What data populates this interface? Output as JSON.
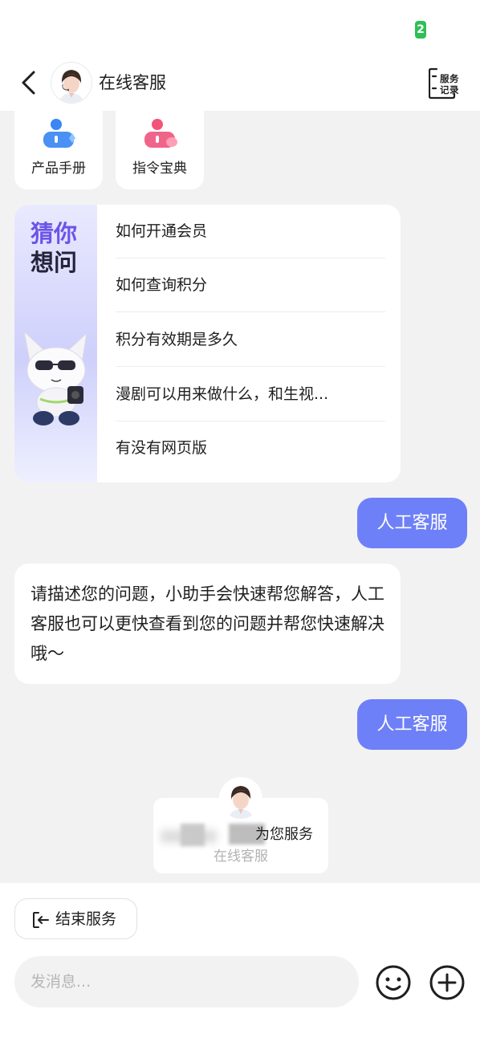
{
  "status_bar": {
    "battery_text": "2"
  },
  "header": {
    "title": "在线客服",
    "service_record_line1": "服务",
    "service_record_line2": "记录"
  },
  "quick_tools": [
    {
      "label": "产品手册",
      "icon": "product-manual-icon",
      "color": "#3a86f2"
    },
    {
      "label": "指令宝典",
      "icon": "command-book-icon",
      "color": "#f2557a"
    }
  ],
  "guess": {
    "title_line1": "猜你",
    "title_line2": "想问",
    "questions": [
      "如何开通会员",
      "如何查询积分",
      "积分有效期是多久",
      "漫剧可以用来做什么，和生视...",
      "有没有网页版"
    ]
  },
  "messages": {
    "user_1": "人工客服",
    "bot_1": "请描述您的问题，小助手会快速帮您解答，人工客服也可以更快查看到您的问题并帮您快速解决哦～",
    "user_2": "人工客服"
  },
  "agent_join": {
    "text": "为您服务",
    "sub": "在线客服"
  },
  "footer": {
    "end_service_label": "结束服务",
    "input_placeholder": "发消息..."
  },
  "colors": {
    "accent": "#6e80f7",
    "guess_title": "#6a55e8",
    "battery": "#2fbf57"
  }
}
